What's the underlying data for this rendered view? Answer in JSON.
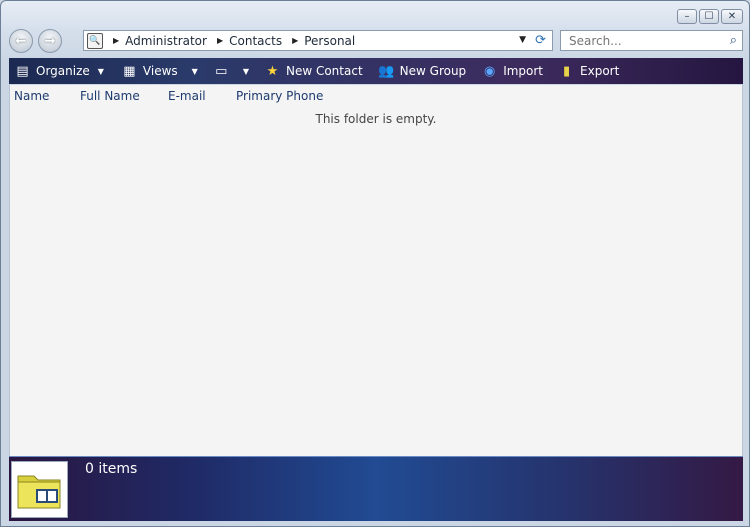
{
  "window": {
    "minimize_label": "–",
    "maximize_label": "☐",
    "close_label": "✕"
  },
  "nav": {
    "back_label": "←",
    "forward_label": "→"
  },
  "address": {
    "crumbs": [
      "Administrator",
      "Contacts",
      "Personal"
    ],
    "dropdown_icon": "chevron-down-icon",
    "refresh_icon": "refresh-icon"
  },
  "search": {
    "placeholder": "Search..."
  },
  "toolbar": {
    "organize_label": "Organize",
    "views_label": "Views",
    "new_contact_label": "New Contact",
    "new_group_label": "New Group",
    "import_label": "Import",
    "export_label": "Export"
  },
  "columns": [
    "Name",
    "Full Name",
    "E-mail",
    "Primary Phone"
  ],
  "content": {
    "empty_message": "This folder is empty."
  },
  "details": {
    "item_count": "0 items"
  },
  "colors": {
    "toolbar_bg": "#2a3a6a",
    "details_accent": "#214b93",
    "column_header_text": "#1d3a6e"
  }
}
